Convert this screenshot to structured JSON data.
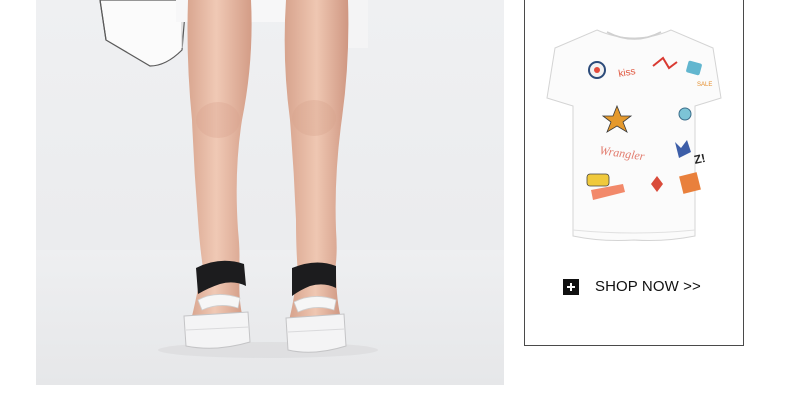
{
  "product_photo": {
    "icon": "sandals-on-legs-photo"
  },
  "product_card": {
    "image_icon": "white-tshirt-with-patches",
    "shop_now": {
      "icon": "plus-icon",
      "label": "SHOP NOW >>"
    }
  },
  "colors": {
    "background": "#ffffff",
    "photo_background": "#ecedef",
    "card_border": "#4a4a4a",
    "text": "#111111"
  }
}
